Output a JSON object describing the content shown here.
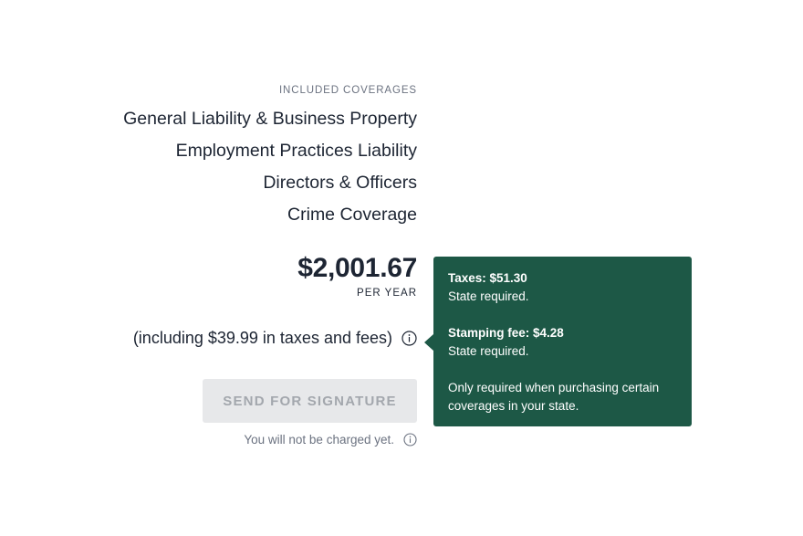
{
  "coverages": {
    "label": "INCLUDED COVERAGES",
    "items": [
      "General Liability & Business Property",
      "Employment Practices Liability",
      "Directors & Officers",
      "Crime Coverage"
    ]
  },
  "price": {
    "amount": "$2,001.67",
    "period": "PER YEAR"
  },
  "taxes": {
    "text": "(including $39.99 in taxes and fees)",
    "icon": "info-icon"
  },
  "action": {
    "send_label": "SEND FOR SIGNATURE",
    "disabled": true
  },
  "charge_note": {
    "text": "You will not be charged yet.",
    "icon": "info-icon"
  },
  "tooltip": {
    "sections": [
      {
        "title": "Taxes: $51.30",
        "body": "State required."
      },
      {
        "title": "Stamping fee: $4.28",
        "body": "State required."
      },
      {
        "title": "",
        "body": "Only required when purchasing certain coverages in your state."
      }
    ]
  },
  "colors": {
    "tooltip_bg": "#1d5846",
    "text_primary": "#1d2533",
    "text_muted": "#6b7280",
    "button_disabled_bg": "#e7e8ea",
    "button_disabled_text": "#a3a7ad"
  }
}
